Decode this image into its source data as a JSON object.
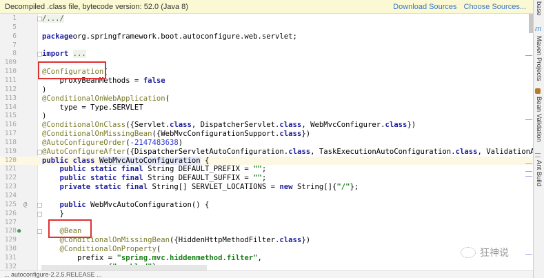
{
  "banner": {
    "text": "Decompiled .class file, bytecode version: 52.0 (Java 8)",
    "download_sources": "Download Sources",
    "choose_sources": "Choose Sources..."
  },
  "side_tabs": [
    "base",
    "Maven Projects",
    "Bean Validation",
    "Ant Build"
  ],
  "watermark": "狂神说",
  "status_text": "... autoconfigure-2.2.5.RELEASE ...",
  "current_line": "120",
  "lines": [
    {
      "n": "1",
      "fold": true,
      "tokens": [
        [
          "fold-txt",
          "/.../"
        ]
      ]
    },
    {
      "n": "5",
      "tokens": []
    },
    {
      "n": "6",
      "tokens": [
        [
          "kw",
          "package"
        ],
        [
          "",
          "org.springframework.boot.autoconfigure.web.servlet;"
        ]
      ]
    },
    {
      "n": "7",
      "tokens": []
    },
    {
      "n": "8",
      "fold": true,
      "tokens": [
        [
          "kw",
          "import"
        ],
        [
          "",
          " "
        ],
        [
          "fold-txt",
          "..."
        ]
      ]
    },
    {
      "n": "109",
      "tokens": []
    },
    {
      "n": "110",
      "tokens": [
        [
          "an",
          "@Configuration"
        ],
        [
          "",
          "("
        ]
      ]
    },
    {
      "n": "111",
      "tokens": [
        [
          "",
          "    proxyBeanMethods = "
        ],
        [
          "kw",
          "false"
        ]
      ]
    },
    {
      "n": "112",
      "tokens": [
        [
          "",
          ")"
        ]
      ]
    },
    {
      "n": "113",
      "tokens": [
        [
          "an",
          "@ConditionalOnWebApplication"
        ],
        [
          "",
          "("
        ]
      ]
    },
    {
      "n": "114",
      "tokens": [
        [
          "",
          "    type = Type.SERVLET"
        ]
      ]
    },
    {
      "n": "115",
      "tokens": [
        [
          "",
          ")"
        ]
      ]
    },
    {
      "n": "116",
      "tokens": [
        [
          "an",
          "@ConditionalOnClass"
        ],
        [
          "",
          "({Servlet."
        ],
        [
          "kw",
          "class"
        ],
        [
          "",
          ", DispatcherServlet."
        ],
        [
          "kw",
          "class"
        ],
        [
          "",
          ", WebMvcConfigurer."
        ],
        [
          "kw",
          "class"
        ],
        [
          "",
          "})"
        ]
      ]
    },
    {
      "n": "117",
      "tokens": [
        [
          "an",
          "@ConditionalOnMissingBean"
        ],
        [
          "",
          "({WebMvcConfigurationSupport."
        ],
        [
          "kw",
          "class"
        ],
        [
          "",
          "})"
        ]
      ]
    },
    {
      "n": "118",
      "tokens": [
        [
          "an",
          "@AutoConfigureOrder"
        ],
        [
          "",
          "("
        ],
        [
          "num",
          "-2147483638"
        ],
        [
          "",
          ")"
        ]
      ]
    },
    {
      "n": "119",
      "fold": true,
      "tokens": [
        [
          "an",
          "@AutoConfigureAfter"
        ],
        [
          "",
          "({DispatcherServletAutoConfiguration."
        ],
        [
          "kw",
          "class"
        ],
        [
          "",
          ", TaskExecutionAutoConfiguration."
        ],
        [
          "kw",
          "class"
        ],
        [
          "",
          ", ValidationAutoCon"
        ]
      ]
    },
    {
      "n": "120",
      "tokens": [
        [
          "kw",
          "public class"
        ],
        [
          "",
          " "
        ],
        [
          "sel",
          "WebMvcAutoConfiguration"
        ],
        [
          "",
          " {"
        ]
      ]
    },
    {
      "n": "121",
      "tokens": [
        [
          "",
          "    "
        ],
        [
          "kw",
          "public static final"
        ],
        [
          "",
          " String DEFAULT_PREFIX = "
        ],
        [
          "str",
          "\"\""
        ],
        [
          "",
          ";"
        ]
      ]
    },
    {
      "n": "122",
      "tokens": [
        [
          "",
          "    "
        ],
        [
          "kw",
          "public static final"
        ],
        [
          "",
          " String DEFAULT_SUFFIX = "
        ],
        [
          "str",
          "\"\""
        ],
        [
          "",
          ";"
        ]
      ]
    },
    {
      "n": "123",
      "tokens": [
        [
          "",
          "    "
        ],
        [
          "kw",
          "private static final"
        ],
        [
          "",
          " String[] SERVLET_LOCATIONS = "
        ],
        [
          "kw",
          "new"
        ],
        [
          "",
          " String[]{"
        ],
        [
          "str",
          "\"/\""
        ],
        [
          "",
          "};"
        ]
      ]
    },
    {
      "n": "124",
      "tokens": []
    },
    {
      "n": "125",
      "icon": "@",
      "fold": true,
      "tokens": [
        [
          "",
          "    "
        ],
        [
          "kw",
          "public"
        ],
        [
          "",
          " WebMvcAutoConfiguration() {"
        ]
      ]
    },
    {
      "n": "126",
      "fold": true,
      "tokens": [
        [
          "",
          "    }"
        ]
      ]
    },
    {
      "n": "127",
      "tokens": []
    },
    {
      "n": "128",
      "icon": "bean",
      "fold": true,
      "tokens": [
        [
          "",
          "    "
        ],
        [
          "an",
          "@Bean"
        ]
      ]
    },
    {
      "n": "129",
      "tokens": [
        [
          "",
          "    "
        ],
        [
          "an",
          "@ConditionalOnMissingBean"
        ],
        [
          "",
          "({HiddenHttpMethodFilter."
        ],
        [
          "kw",
          "class"
        ],
        [
          "",
          "})"
        ]
      ]
    },
    {
      "n": "130",
      "tokens": [
        [
          "",
          "    "
        ],
        [
          "an",
          "@ConditionalOnProperty"
        ],
        [
          "",
          "("
        ]
      ]
    },
    {
      "n": "131",
      "tokens": [
        [
          "",
          "        prefix = "
        ],
        [
          "str",
          "\"spring.mvc.hiddenmethod.filter\""
        ],
        [
          "",
          ","
        ]
      ]
    },
    {
      "n": "132",
      "tokens": [
        [
          "",
          "        name = {"
        ],
        [
          "str",
          "\"enabled\""
        ],
        [
          "",
          "},"
        ]
      ]
    }
  ]
}
